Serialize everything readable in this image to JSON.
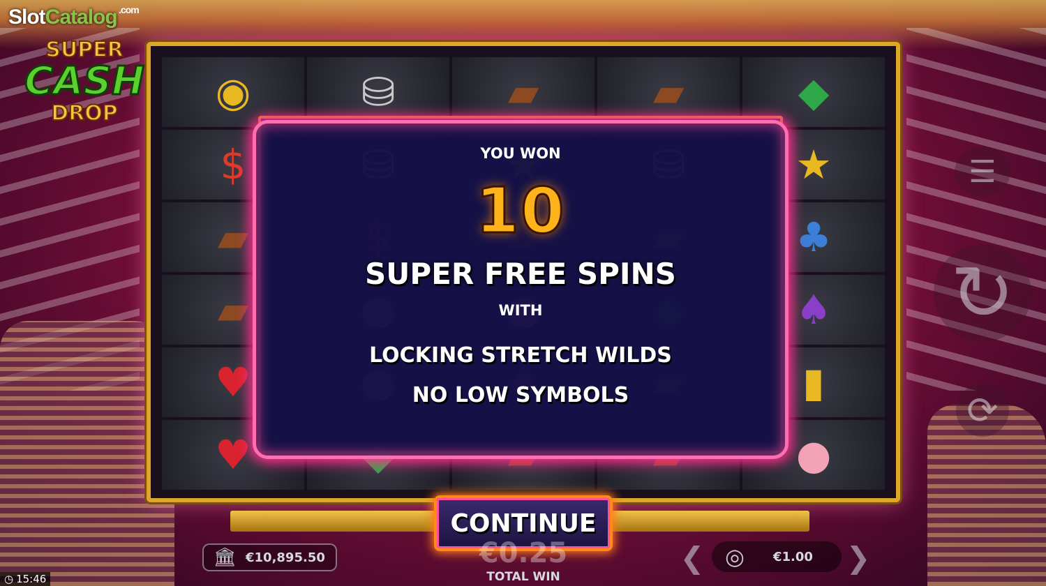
{
  "watermark": {
    "slot": "Slot",
    "catalog": "Catalog",
    "com": ".com"
  },
  "game_logo": {
    "line1": "SUPER",
    "line2": "CASH",
    "line3": "DROP"
  },
  "reels": [
    [
      "coin-icon",
      "chips-icon",
      "wallet-icon",
      "wallet-icon",
      "diamond-icon"
    ],
    [
      "dollar-icon",
      "chips-icon",
      "bonus-icon",
      "chips-icon",
      "bonus-icon"
    ],
    [
      "wallet-icon",
      "dollar-icon",
      "wallet-icon",
      "wallet-icon",
      "club-icon"
    ],
    [
      "wallet-icon",
      "piggy-icon",
      "piggy-icon",
      "diamond-icon",
      "spade-icon"
    ],
    [
      "heart-icon",
      "piggy-icon",
      "spade-icon",
      "wallet-icon",
      "gold-bar-icon"
    ],
    [
      "heart-icon",
      "diamond-icon",
      "wallet-icon",
      "wallet-icon",
      "piggy-icon"
    ]
  ],
  "popup": {
    "you_won": "YOU WON",
    "spin_count": "10",
    "title": "SUPER FREE SPINS",
    "with": "WITH",
    "feature_1": "LOCKING STRETCH WILDS",
    "feature_2": "NO LOW SYMBOLS"
  },
  "continue_label": "CONTINUE",
  "hud": {
    "balance": "€10,895.50",
    "total_win_amount": "€0.25",
    "total_win_label": "TOTAL WIN",
    "bet": "€1.00",
    "clock": "15:46"
  },
  "colors": {
    "accent_pink": "#ff6fb0",
    "accent_orange": "#ff8a1a",
    "gold": "#e0a62a"
  }
}
